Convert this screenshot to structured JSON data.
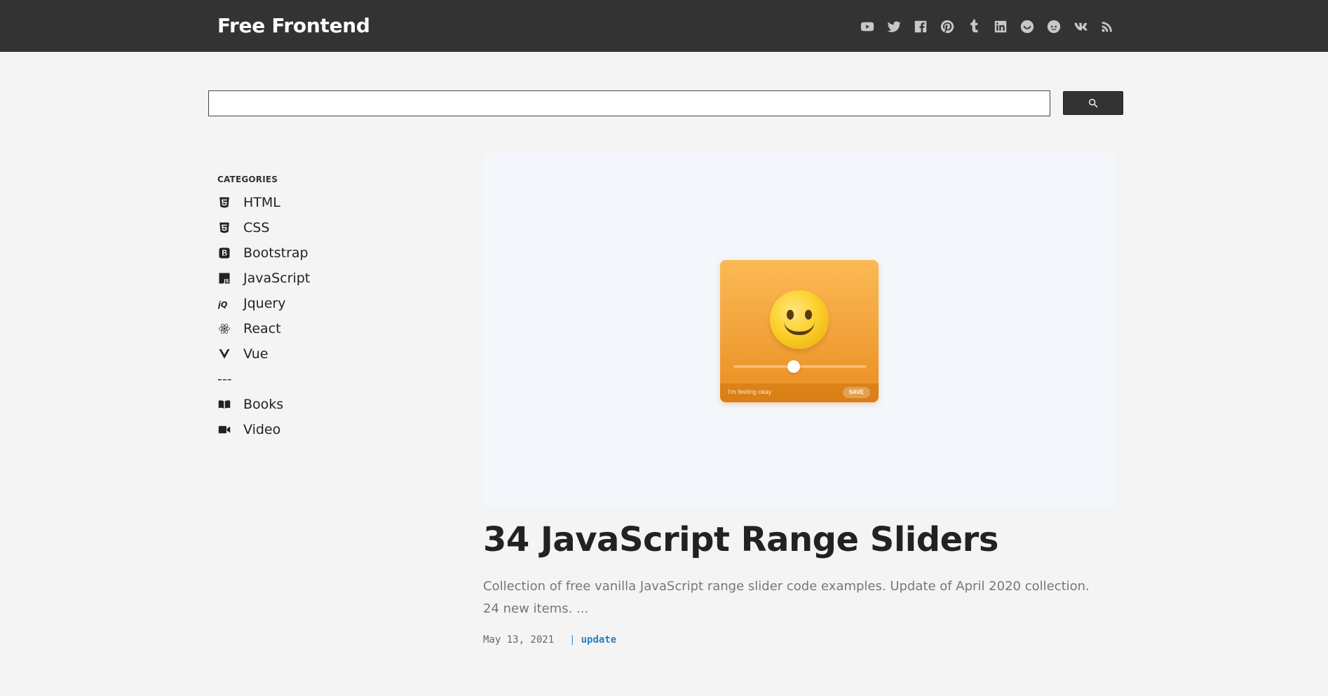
{
  "header": {
    "brand": "Free Frontend",
    "social": [
      {
        "icon": "youtube-icon"
      },
      {
        "icon": "twitter-icon"
      },
      {
        "icon": "facebook-icon"
      },
      {
        "icon": "pinterest-icon"
      },
      {
        "icon": "tumblr-icon"
      },
      {
        "icon": "linkedin-icon"
      },
      {
        "icon": "mix-icon"
      },
      {
        "icon": "reddit-icon"
      },
      {
        "icon": "vk-icon"
      },
      {
        "icon": "rss-icon"
      }
    ]
  },
  "search": {
    "value": "",
    "placeholder": "",
    "button_icon": "search-icon"
  },
  "sidebar": {
    "heading": "CATEGORIES",
    "items": [
      {
        "label": "HTML",
        "icon": "html5-icon"
      },
      {
        "label": "CSS",
        "icon": "css3-icon"
      },
      {
        "label": "Bootstrap",
        "icon": "bootstrap-icon"
      },
      {
        "label": "JavaScript",
        "icon": "javascript-icon"
      },
      {
        "label": "Jquery",
        "icon": "jquery-icon"
      },
      {
        "label": "React",
        "icon": "react-icon"
      },
      {
        "label": "Vue",
        "icon": "vue-icon"
      }
    ],
    "separator": "---",
    "extra_items": [
      {
        "label": "Books",
        "icon": "book-icon"
      },
      {
        "label": "Video",
        "icon": "video-icon"
      }
    ]
  },
  "article": {
    "thumbnail": {
      "feeling_text": "I'm feeling okay",
      "save_label": "SAVE",
      "slider_level": 0.45
    },
    "title": "34 JavaScript Range Sliders",
    "excerpt": "Collection of free vanilla JavaScript range slider code examples. Update of April 2020 collection. 24 new items. ...",
    "date": "May 13, 2021",
    "separator": "|",
    "tag": "update"
  },
  "colors": {
    "header_bg": "#333333",
    "page_bg": "#f4f4f4",
    "thumb_bg": "#f3f6fb",
    "link": "#2a7fc0"
  }
}
